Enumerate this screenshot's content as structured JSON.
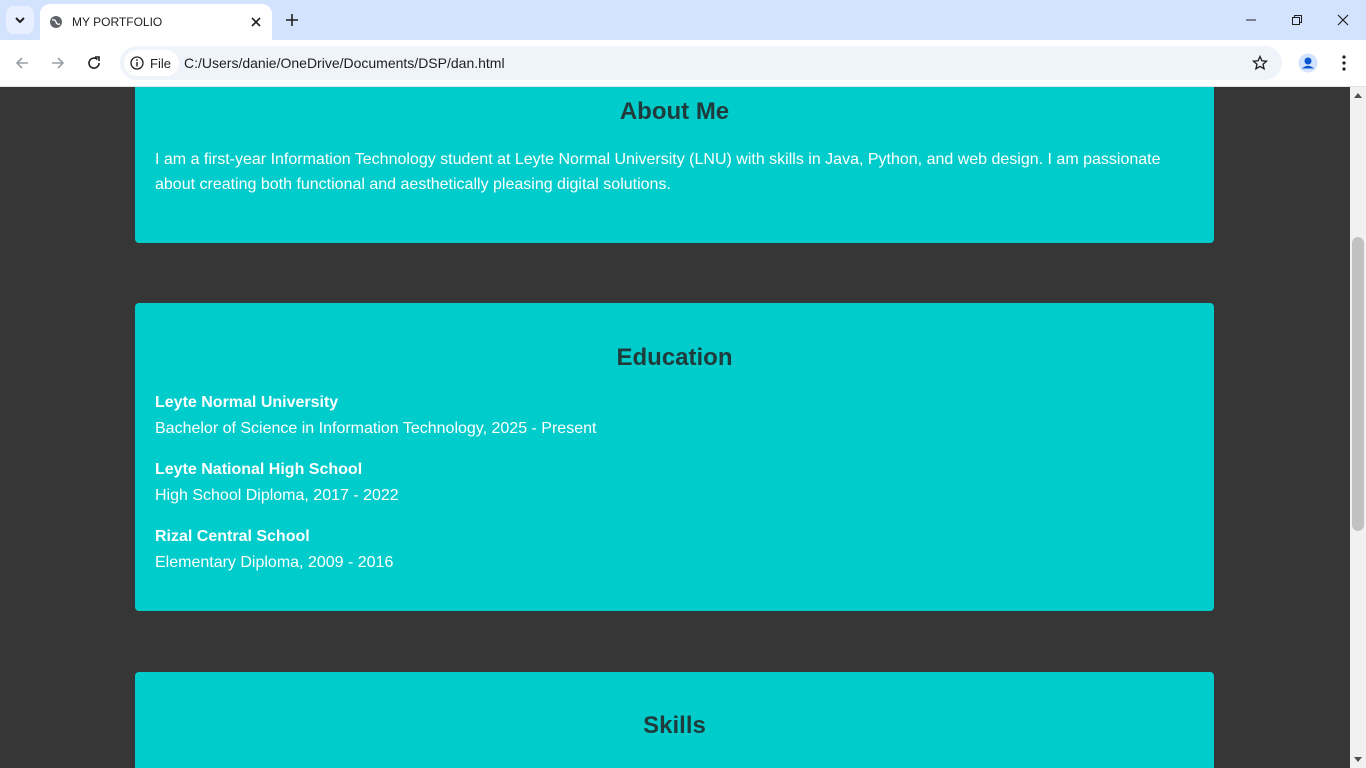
{
  "browser": {
    "tab_title": "MY PORTFOLIO",
    "site_chip_label": "File",
    "url": "C:/Users/danie/OneDrive/Documents/DSP/dan.html"
  },
  "about": {
    "heading": "About Me",
    "text": "I am a first-year Information Technology student at Leyte Normal University (LNU) with skills in Java, Python, and web design. I am passionate about creating both functional and aesthetically pleasing digital solutions."
  },
  "education": {
    "heading": "Education",
    "entries": [
      {
        "school": "Leyte Normal University",
        "detail": "Bachelor of Science in Information Technology, 2025 - Present"
      },
      {
        "school": "Leyte National High School",
        "detail": "High School Diploma, 2017 - 2022"
      },
      {
        "school": "Rizal Central School",
        "detail": "Elementary Diploma, 2009 - 2016"
      }
    ]
  },
  "skills": {
    "heading": "Skills"
  },
  "colors": {
    "card": "#00cccc",
    "page_bg": "#363636",
    "heading": "#1f3b3b",
    "tabbar": "#d3e3fd"
  }
}
